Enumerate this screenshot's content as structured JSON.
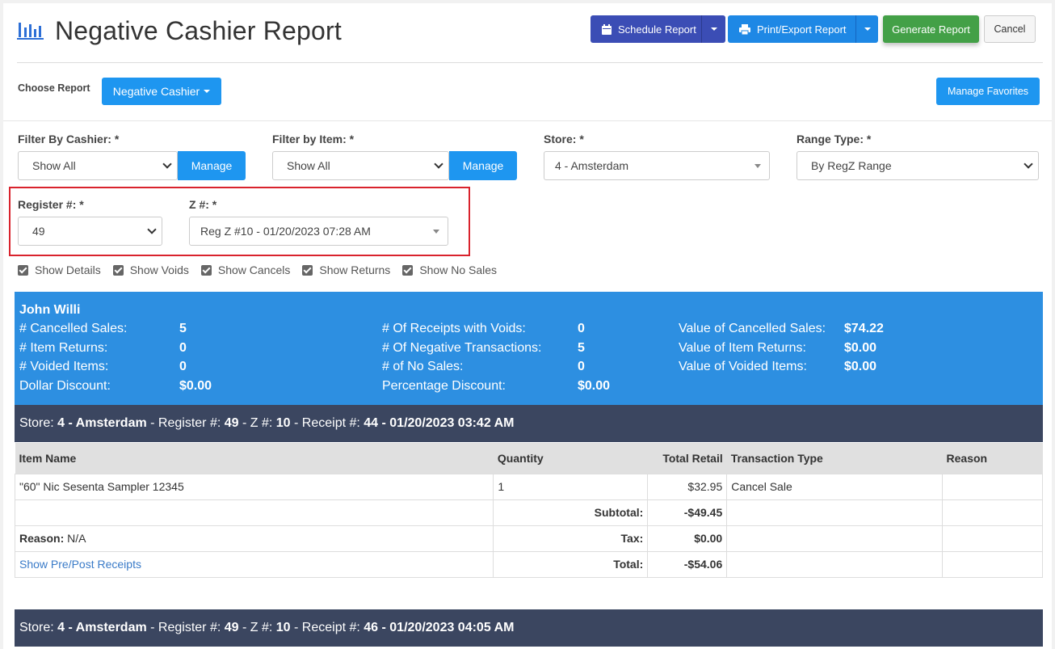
{
  "header": {
    "title": "Negative Cashier Report",
    "schedule_label": "Schedule Report",
    "print_label": "Print/Export Report",
    "generate_label": "Generate Report",
    "cancel_label": "Cancel"
  },
  "choose": {
    "label": "Choose Report",
    "report_value": "Negative Cashier",
    "favorites_label": "Manage Favorites"
  },
  "filters": {
    "cashier_label": "Filter By Cashier: *",
    "cashier_value": "Show All",
    "item_label": "Filter by Item: *",
    "item_value": "Show All",
    "manage_label": "Manage",
    "store_label": "Store: *",
    "store_value": "4 - Amsterdam",
    "range_label": "Range Type: *",
    "range_value": "By RegZ Range",
    "register_label": "Register #: *",
    "register_value": "49",
    "z_label": "Z #: *",
    "z_value": "Reg Z #10 - 01/20/2023 07:28 AM"
  },
  "options": [
    "Show Details",
    "Show Voids",
    "Show Cancels",
    "Show Returns",
    "Show No Sales"
  ],
  "summary": {
    "cashier": "John Willi",
    "col1": [
      {
        "label": "# Cancelled Sales:",
        "value": "5"
      },
      {
        "label": "# Item Returns:",
        "value": "0"
      },
      {
        "label": "# Voided Items:",
        "value": "0"
      },
      {
        "label": "Dollar Discount:",
        "value": "$0.00"
      }
    ],
    "col2": [
      {
        "label": "# Of Receipts with Voids:",
        "value": "0"
      },
      {
        "label": "# Of Negative Transactions:",
        "value": "5"
      },
      {
        "label": "# of No Sales:",
        "value": "0"
      },
      {
        "label": "Percentage Discount:",
        "value": "$0.00"
      }
    ],
    "col3": [
      {
        "label": "Value of Cancelled Sales:",
        "value": "$74.22"
      },
      {
        "label": "Value of Item Returns:",
        "value": "$0.00"
      },
      {
        "label": "Value of Voided Items:",
        "value": "$0.00"
      }
    ]
  },
  "receipts": [
    {
      "store_label": "Store",
      "store": "4 - Amsterdam",
      "register_label": "Register #",
      "register": "49",
      "z_label": "Z #",
      "z": "10",
      "receipt_label": "Receipt #",
      "receipt": "44 - 01/20/2023 03:42 AM"
    },
    {
      "store_label": "Store",
      "store": "4 - Amsterdam",
      "register_label": "Register #",
      "register": "49",
      "z_label": "Z #",
      "z": "10",
      "receipt_label": "Receipt #",
      "receipt": "46 - 01/20/2023 04:05 AM"
    }
  ],
  "table": {
    "headers": {
      "item_name": "Item Name",
      "quantity": "Quantity",
      "total_retail": "Total Retail",
      "transaction_type": "Transaction Type",
      "reason": "Reason"
    },
    "row": {
      "item_name": "\"60\" Nic Sesenta Sampler 12345",
      "quantity": "1",
      "total_retail": "$32.95",
      "transaction_type": "Cancel Sale",
      "reason": ""
    },
    "subtotal_label": "Subtotal:",
    "subtotal_value": "-$49.45",
    "reason_label": "Reason:",
    "reason_value": "N/A",
    "tax_label": "Tax:",
    "tax_value": "$0.00",
    "show_receipts_link": "Show Pre/Post Receipts",
    "total_label": "Total:",
    "total_value": "-$54.06"
  },
  "colors": {
    "schedule": "#3b4db5",
    "primary": "#1e96f0",
    "generate": "#43a047",
    "summary_bg": "#2d8fe1",
    "banner_bg": "#3b4660",
    "highlight_box": "#d9232d"
  }
}
